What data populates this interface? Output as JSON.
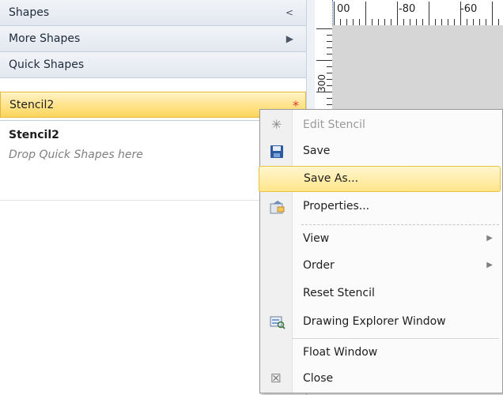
{
  "shapes_pane": {
    "rows": [
      {
        "label": "Shapes",
        "arrow": "<"
      },
      {
        "label": "More Shapes",
        "arrow": "▶"
      },
      {
        "label": "Quick Shapes"
      },
      {
        "label": "Stencil2",
        "badge": "*"
      }
    ],
    "stencil": {
      "title": "Stencil2",
      "hint": "Drop Quick Shapes here"
    }
  },
  "ruler": {
    "h_labels": [
      "00",
      "-80",
      "-60"
    ],
    "v_label": "300"
  },
  "context_menu": {
    "items": [
      {
        "label": "Edit Stencil",
        "disabled": true
      },
      {
        "label": "Save"
      },
      {
        "label": "Save As...",
        "highlighted": true
      },
      {
        "label": "Properties..."
      },
      {
        "label": "View",
        "submenu": true
      },
      {
        "label": "Order",
        "submenu": true
      },
      {
        "label": "Reset Stencil"
      },
      {
        "label": "Drawing Explorer Window"
      },
      {
        "label": "Float Window"
      },
      {
        "label": "Close"
      }
    ]
  },
  "colors": {
    "accent_highlight": "#ffe58a",
    "modified_star": "#e0382b",
    "pane_bg": "#e2e8f0"
  }
}
